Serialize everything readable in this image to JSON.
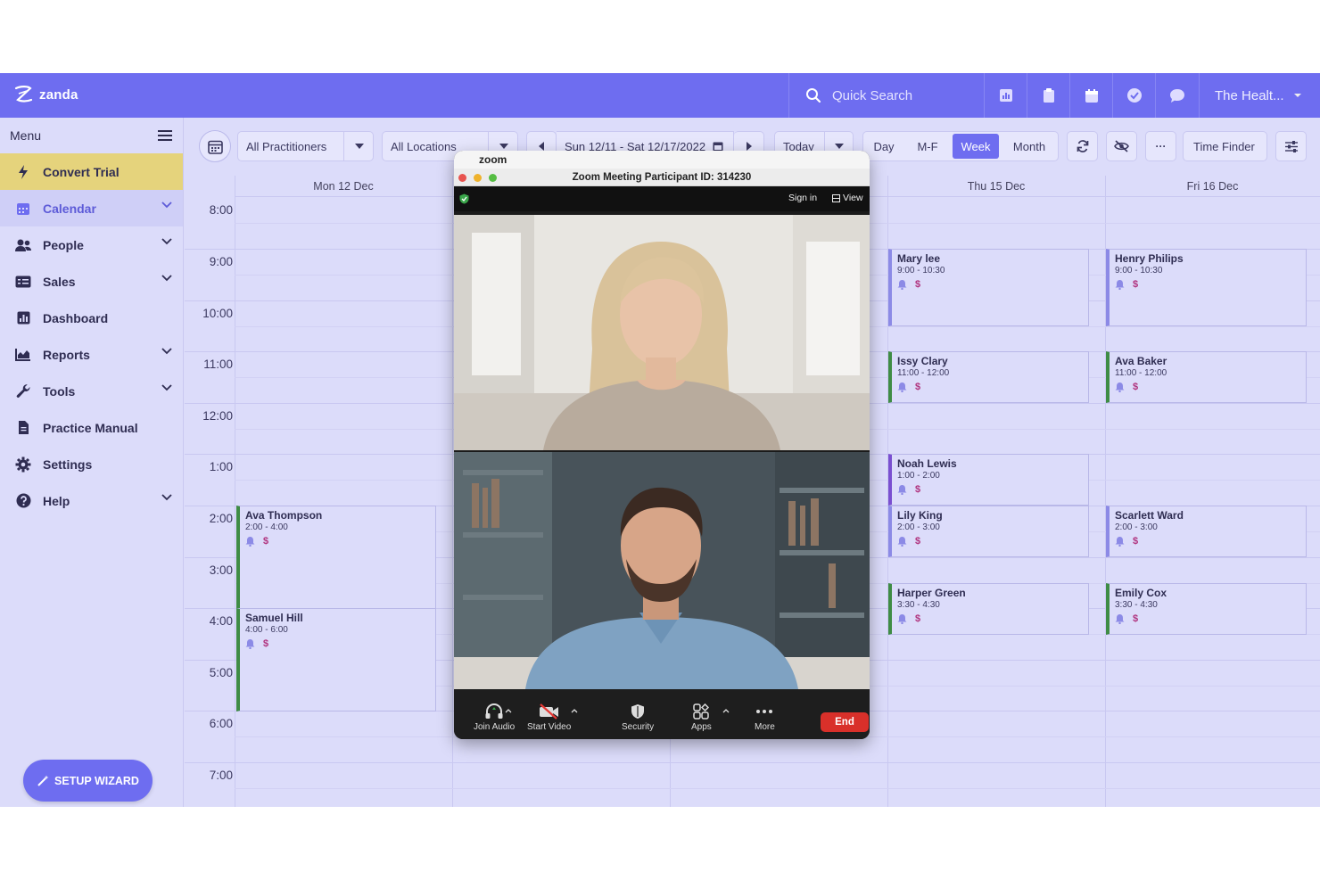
{
  "topbar": {
    "logo_text": "zanda",
    "search_placeholder": "Quick Search",
    "org_name": "The Healt...",
    "icons": [
      "chart-icon",
      "clipboard-icon",
      "calendar-icon",
      "check-circle-icon",
      "chat-icon"
    ]
  },
  "sidebar": {
    "menu_label": "Menu",
    "items": [
      {
        "label": "Convert Trial",
        "icon": "bolt-icon"
      },
      {
        "label": "Calendar",
        "icon": "calendar-icon"
      },
      {
        "label": "People",
        "icon": "people-icon"
      },
      {
        "label": "Sales",
        "icon": "sales-icon"
      },
      {
        "label": "Dashboard",
        "icon": "dashboard-icon"
      },
      {
        "label": "Reports",
        "icon": "reports-icon"
      },
      {
        "label": "Tools",
        "icon": "wrench-icon"
      },
      {
        "label": "Practice Manual",
        "icon": "document-icon"
      },
      {
        "label": "Settings",
        "icon": "gear-icon"
      },
      {
        "label": "Help",
        "icon": "help-icon"
      }
    ],
    "setup_wizard": "SETUP WIZARD"
  },
  "toolbar": {
    "practitioners": "All Practitioners",
    "locations": "All Locations",
    "date_range": "Sun 12/11 - Sat 12/17/2022",
    "today": "Today",
    "views": [
      "Day",
      "M-F",
      "Week",
      "Month"
    ],
    "active_view": "Week",
    "more": "···",
    "time_finder": "Time Finder"
  },
  "calendar": {
    "days": [
      "Mon 12 Dec",
      "",
      "",
      "Thu 15 Dec",
      "Fri 16 Dec"
    ],
    "hours": [
      "8:00",
      "9:00",
      "10:00",
      "11:00",
      "12:00",
      "1:00",
      "2:00",
      "3:00",
      "4:00",
      "5:00",
      "6:00",
      "7:00"
    ],
    "appointments": [
      {
        "name": "Ava Thompson",
        "time": "2:00 - 4:00"
      },
      {
        "name": "Samuel Hill",
        "time": "4:00 - 6:00"
      },
      {
        "name": "Mary lee",
        "time": "9:00 - 10:30"
      },
      {
        "name": "Issy Clary",
        "time": "11:00 - 12:00"
      },
      {
        "name": "Noah Lewis",
        "time": "1:00 - 2:00"
      },
      {
        "name": "Lily King",
        "time": "2:00 - 3:00"
      },
      {
        "name": "Harper Green",
        "time": "3:30 - 4:30"
      },
      {
        "name": "Henry Philips",
        "time": "9:00 - 10:30"
      },
      {
        "name": "Ava Baker",
        "time": "11:00 - 12:00"
      },
      {
        "name": "Scarlett Ward",
        "time": "2:00 - 3:00"
      },
      {
        "name": "Emily Cox",
        "time": "3:30 - 4:30"
      }
    ],
    "dollar": "$"
  },
  "zoom": {
    "app_name": "zoom",
    "title": "Zoom Meeting Participant ID: 314230",
    "sign_in": "Sign in",
    "view": "View",
    "controls": [
      "Join Audio",
      "Start Video",
      "Security",
      "Apps",
      "More"
    ],
    "end": "End"
  },
  "colors": {
    "brand": "#6e6df0",
    "background": "#dcdcfa",
    "trial": "#e5d37c",
    "end_button": "#d9302a"
  }
}
